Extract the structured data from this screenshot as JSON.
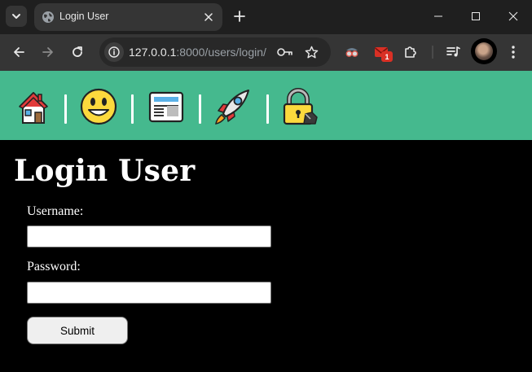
{
  "browser": {
    "tab": {
      "title": "Login User",
      "favicon": "globe-icon"
    },
    "address": {
      "host": "127.0.0.1",
      "rest": ":8000/users/login/"
    },
    "extensions": {
      "mail_badge": "1"
    },
    "colors": {
      "tabstrip": "#1f1f1f",
      "toolbar": "#353535",
      "omnibox": "#282828"
    }
  },
  "navbar": {
    "background": "#45b98e",
    "separator": "|",
    "items": [
      {
        "icon": "house-icon",
        "link": "home"
      },
      {
        "icon": "smiley-icon",
        "link": "about"
      },
      {
        "icon": "newspaper-icon",
        "link": "news"
      },
      {
        "icon": "rocket-icon",
        "link": "projects"
      },
      {
        "icon": "lock-with-pen-icon",
        "link": "login"
      }
    ]
  },
  "page": {
    "title": "Login User",
    "form": {
      "username_label": "Username:",
      "username_value": "",
      "password_label": "Password:",
      "password_value": "",
      "submit_label": "Submit"
    }
  }
}
